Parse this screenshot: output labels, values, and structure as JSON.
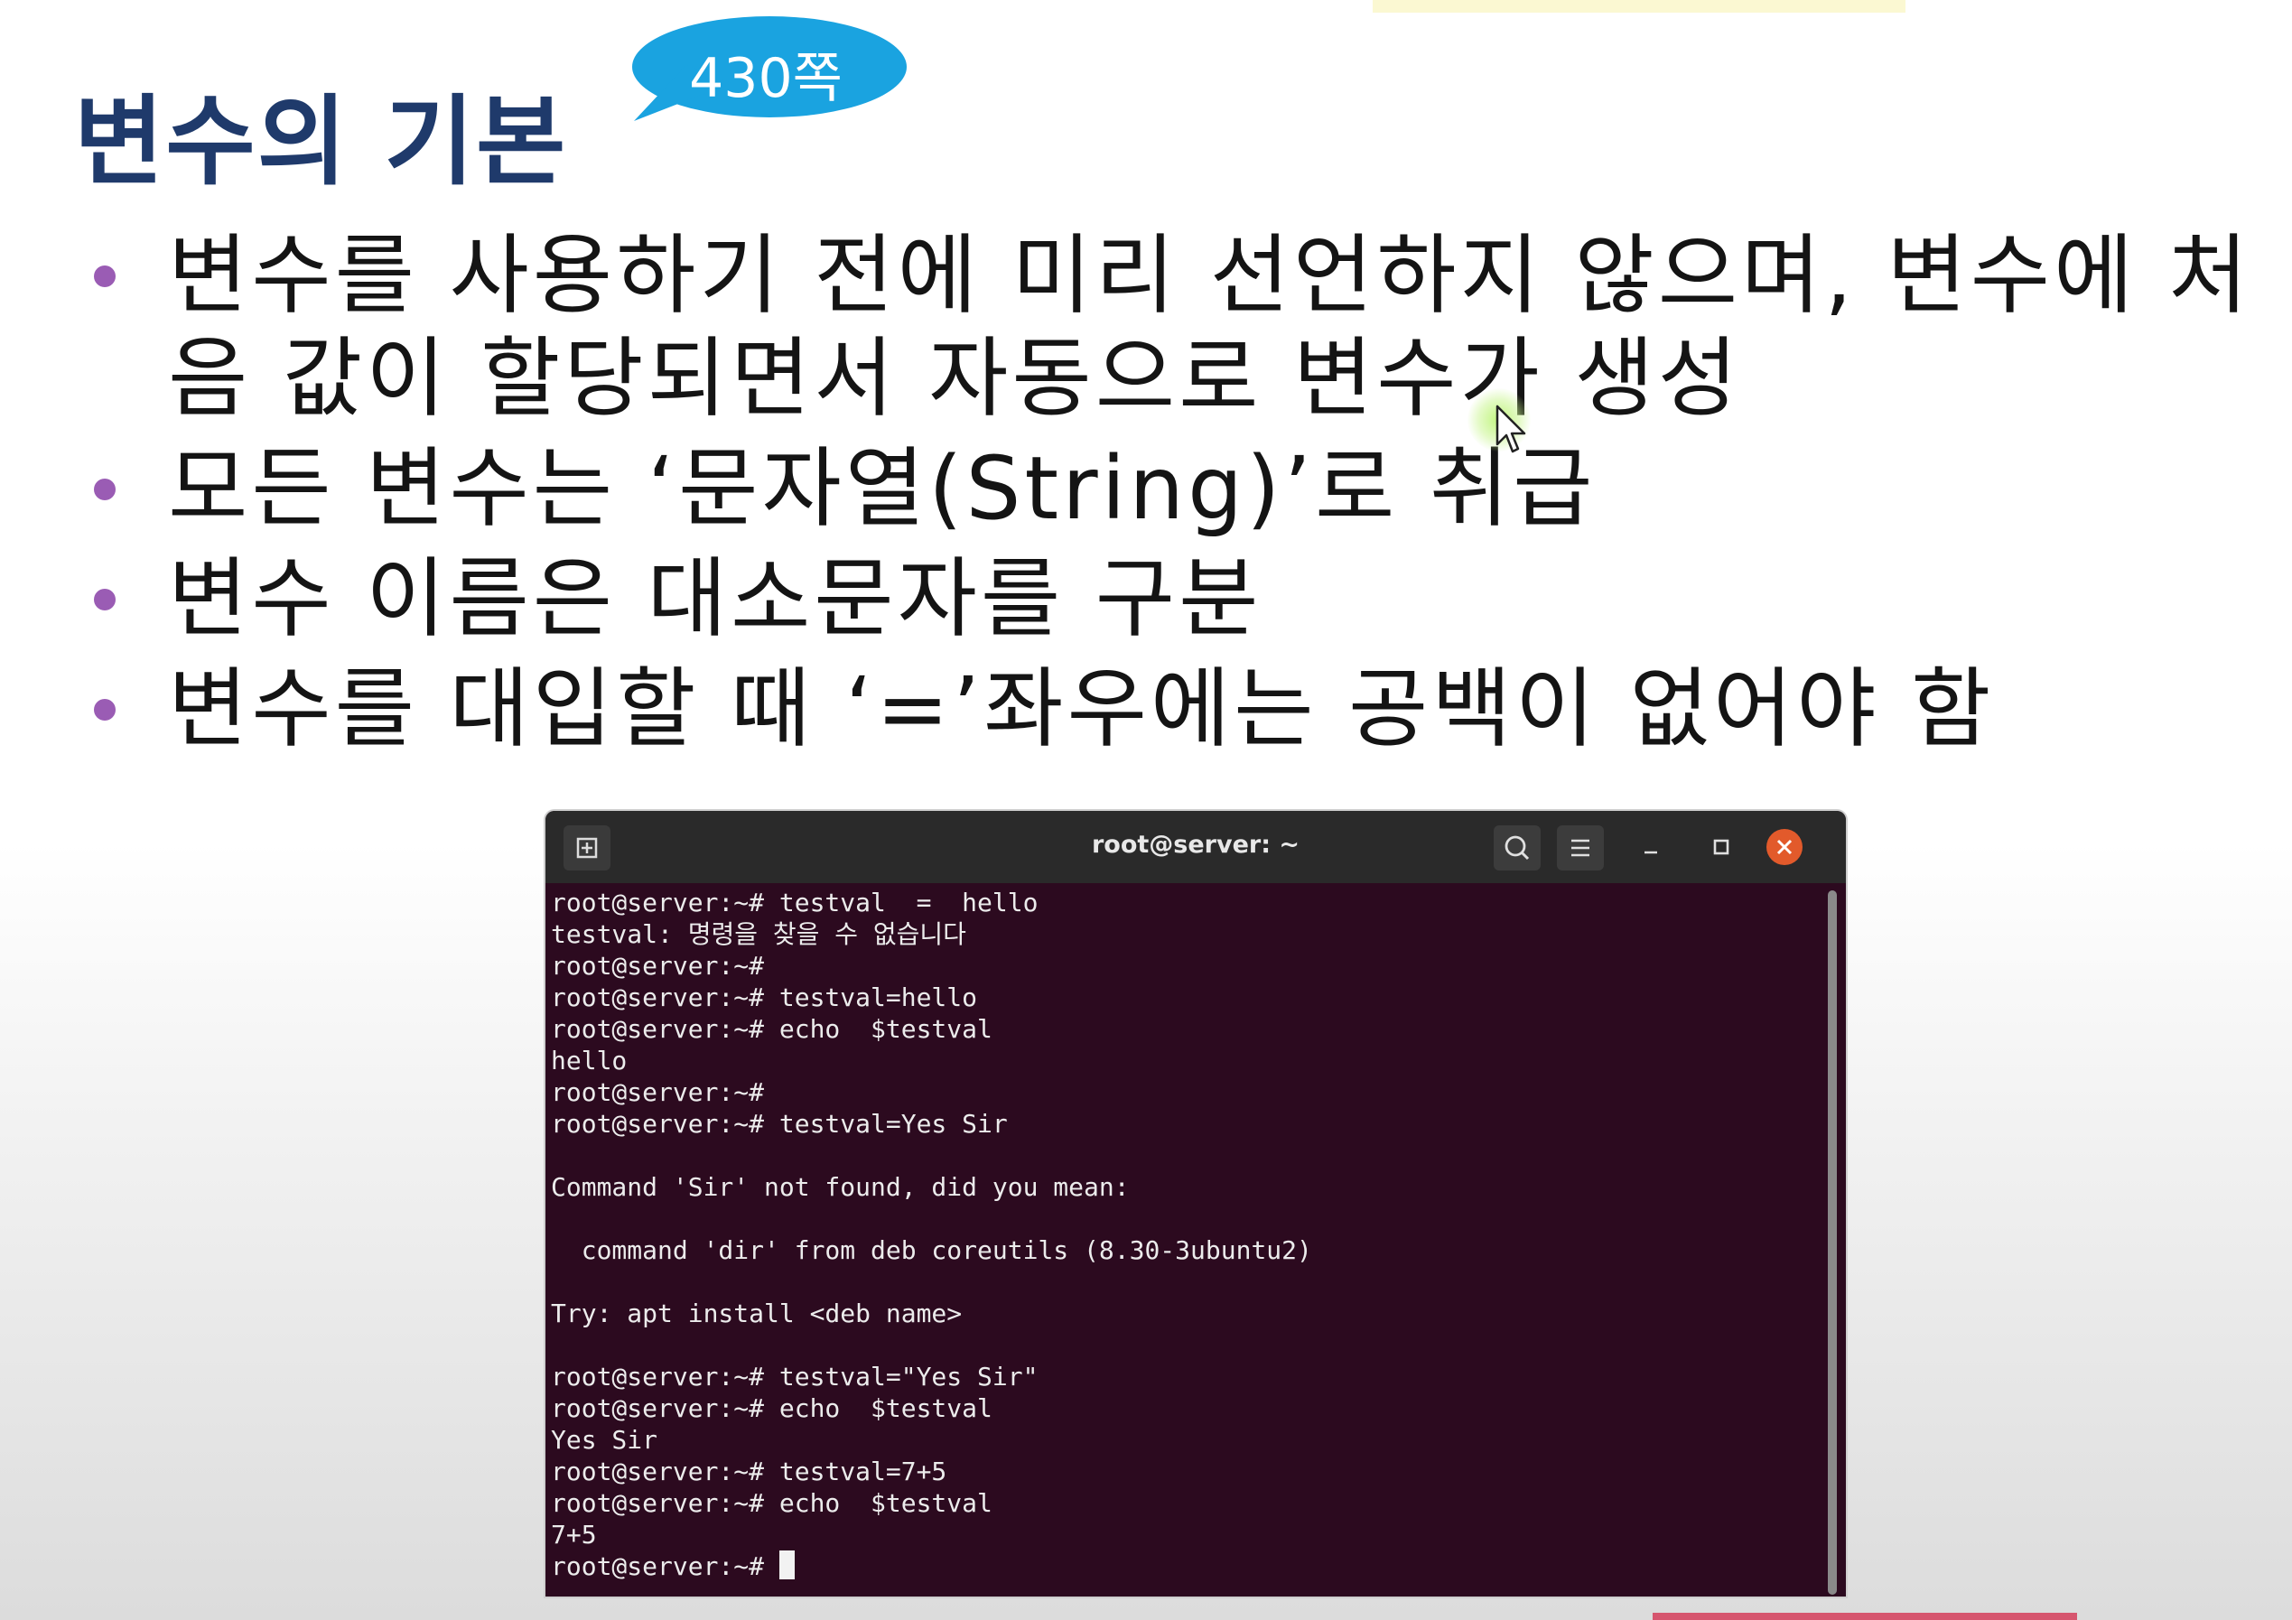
{
  "slide": {
    "title": "변수의 기본",
    "page_bubble": "430쪽",
    "bullets": [
      "변수를 사용하기 전에 미리 선언하지 않으며, 변수에 처음 값이 할당되면서 자동으로 변수가 생성",
      "모든 변수는 ‘문자열(String)’로 취급",
      "변수 이름은 대소문자를 구분",
      "변수를 대입할 때 ‘=’좌우에는 공백이 없어야 함"
    ]
  },
  "terminal": {
    "title": "root@server: ~",
    "prompt_last": "root@server:~#",
    "lines": [
      "root@server:~# testval  =  hello",
      "testval: 명령을 찾을 수 없습니다",
      "root@server:~#",
      "root@server:~# testval=hello",
      "root@server:~# echo  $testval",
      "hello",
      "root@server:~#",
      "root@server:~# testval=Yes Sir",
      "",
      "Command 'Sir' not found, did you mean:",
      "",
      "  command 'dir' from deb coreutils (8.30-3ubuntu2)",
      "",
      "Try: apt install <deb name>",
      "",
      "root@server:~# testval=\"Yes Sir\"",
      "root@server:~# echo  $testval",
      "Yes Sir",
      "root@server:~# testval=7+5",
      "root@server:~# echo  $testval",
      "7+5"
    ]
  },
  "icons": {
    "new_tab": "new-tab-icon",
    "search": "search-icon",
    "menu": "hamburger-menu-icon",
    "minimize": "minimize-icon",
    "maximize": "maximize-icon",
    "close": "close-icon",
    "pointer": "mouse-pointer-icon"
  },
  "colors": {
    "title": "#1f3a6b",
    "bubble": "#1aa3e0",
    "bullet_dot": "#9a5cb4",
    "terminal_bg": "#2c0a1f",
    "terminal_header": "#2a2a2a",
    "close_button": "#e25a2b"
  }
}
